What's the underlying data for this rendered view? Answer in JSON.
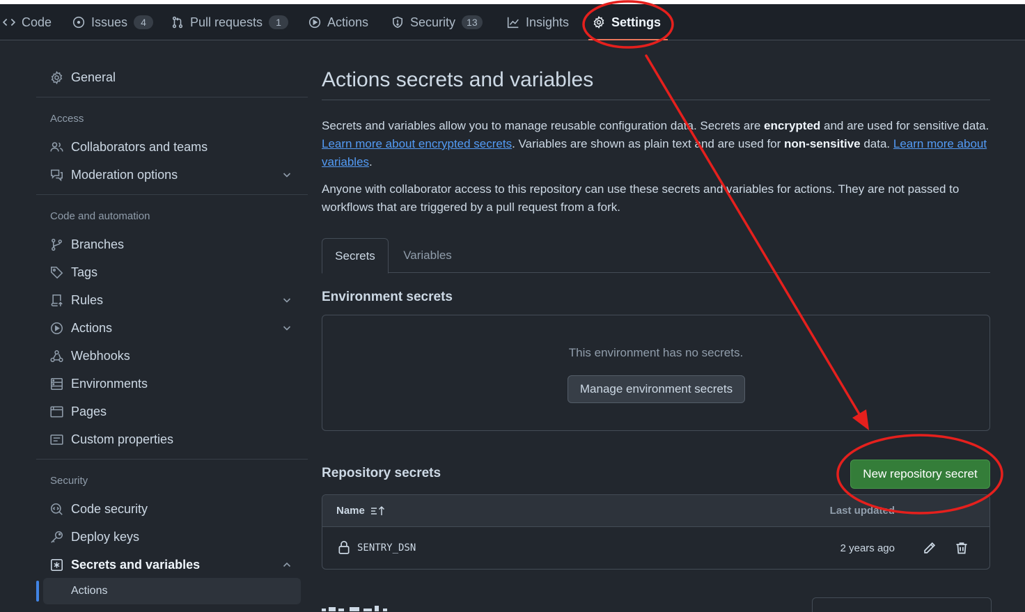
{
  "repo_nav": {
    "tabs": [
      {
        "label": "Code",
        "icon": "code-icon"
      },
      {
        "label": "Issues",
        "icon": "issue-opened-icon",
        "count": "4"
      },
      {
        "label": "Pull requests",
        "icon": "git-pull-request-icon",
        "count": "1"
      },
      {
        "label": "Actions",
        "icon": "play-icon"
      },
      {
        "label": "Security",
        "icon": "shield-icon",
        "count": "13"
      },
      {
        "label": "Insights",
        "icon": "graph-icon"
      },
      {
        "label": "Settings",
        "icon": "gear-icon",
        "selected": true
      }
    ]
  },
  "sidebar": {
    "general": "General",
    "access_heading": "Access",
    "access_items": [
      "Collaborators and teams",
      "Moderation options"
    ],
    "code_heading": "Code and automation",
    "code_items": [
      "Branches",
      "Tags",
      "Rules",
      "Actions",
      "Webhooks",
      "Environments",
      "Pages",
      "Custom properties"
    ],
    "security_heading": "Security",
    "security_items": [
      "Code security",
      "Deploy keys",
      "Secrets and variables"
    ],
    "sub_items": [
      "Actions"
    ]
  },
  "main": {
    "title": "Actions secrets and variables",
    "intro": {
      "t1": "Secrets and variables allow you to manage reusable configuration data. Secrets are ",
      "b1": "encrypted",
      "t2": " and are used for sensitive data. ",
      "link1": "Learn more about encrypted secrets",
      "t3": ". Variables are shown as plain text and are used for ",
      "b2": "non-sensitive",
      "t4": " data. ",
      "link2": "Learn more about variables",
      "t5": "."
    },
    "note": "Anyone with collaborator access to this repository can use these secrets and variables for actions. They are not passed to workflows that are triggered by a pull request from a fork.",
    "tabs": [
      "Secrets",
      "Variables"
    ],
    "env_heading": "Environment secrets",
    "env_empty": "This environment has no secrets.",
    "env_button": "Manage environment secrets",
    "repo_heading": "Repository secrets",
    "new_button": "New repository secret",
    "table": {
      "col_name": "Name",
      "col_updated": "Last updated",
      "rows": [
        {
          "name": "SENTRY_DSN",
          "updated": "2 years ago"
        }
      ]
    }
  },
  "colors": {
    "background": "#22272e",
    "accent_link": "#539bf5",
    "primary_button": "#347d39",
    "annotation_red": "#e5201d"
  }
}
